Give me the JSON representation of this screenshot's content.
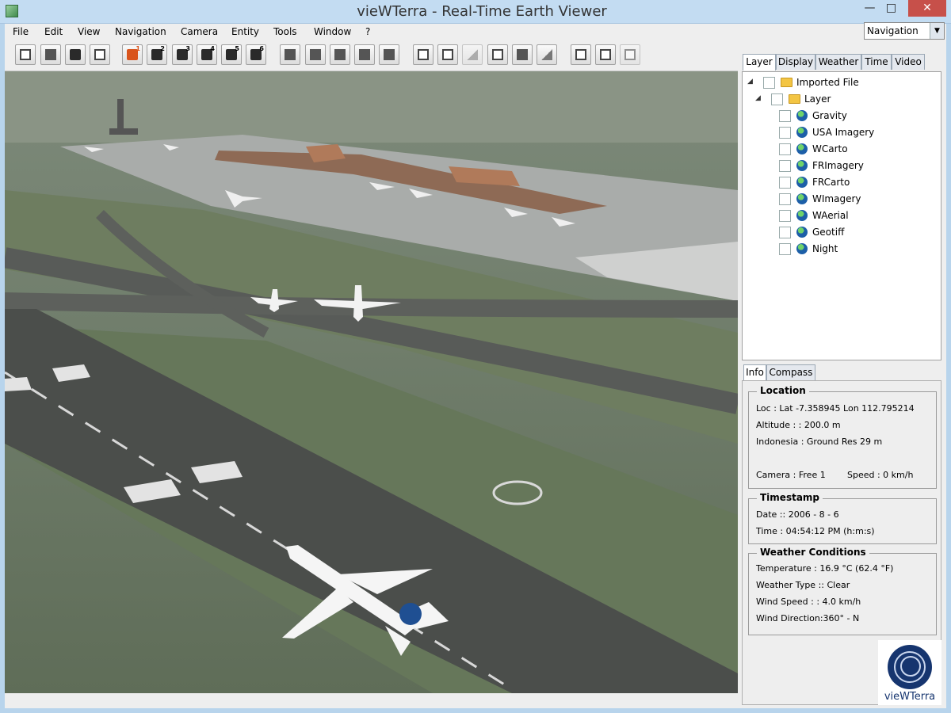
{
  "window": {
    "title": "vieWTerra - Real-Time Earth Viewer"
  },
  "menu": [
    "File",
    "Edit",
    "View",
    "Navigation",
    "Camera",
    "Entity",
    "Tools",
    "Window",
    "?"
  ],
  "nav_select": {
    "value": "Navigation"
  },
  "toolbar": {
    "camera_numbers": [
      "1",
      "2",
      "3",
      "4",
      "5",
      "6"
    ]
  },
  "right_tabs": [
    "Layer",
    "Display",
    "Weather",
    "Time",
    "Video"
  ],
  "layer_tree": {
    "root": "Imported File",
    "group": "Layer",
    "items": [
      "Gravity",
      "USA Imagery",
      "WCarto",
      "FRImagery",
      "FRCarto",
      "WImagery",
      "WAerial",
      "Geotiff",
      "Night"
    ]
  },
  "info_tabs": [
    "Info",
    "Compass"
  ],
  "location": {
    "title": "Location",
    "loc": "Loc : Lat -7.358945 Lon 112.795214",
    "altitude": "Altitude : : 200.0 m",
    "region": "Indonesia : Ground Res 29 m",
    "camera": "Camera : Free 1",
    "speed": "Speed : 0 km/h"
  },
  "timestamp": {
    "title": "Timestamp",
    "date": "Date :: 2006 - 8 - 6",
    "time": "Time :  04:54:12 PM  (h:m:s)"
  },
  "weather": {
    "title": "Weather Conditions",
    "temperature": "Temperature  :  16.9 °C (62.4 °F)",
    "type": "Weather Type :: Clear",
    "wind_speed": "Wind Speed  :  : 4.0 km/h",
    "wind_direction": "Wind Direction:360° - N"
  },
  "logo": {
    "text": "vieWTerra"
  },
  "icons": {
    "minimize": "minimize-icon",
    "maximize": "maximize-icon",
    "close": "close-icon",
    "dropdown": "chevron-down-icon"
  }
}
